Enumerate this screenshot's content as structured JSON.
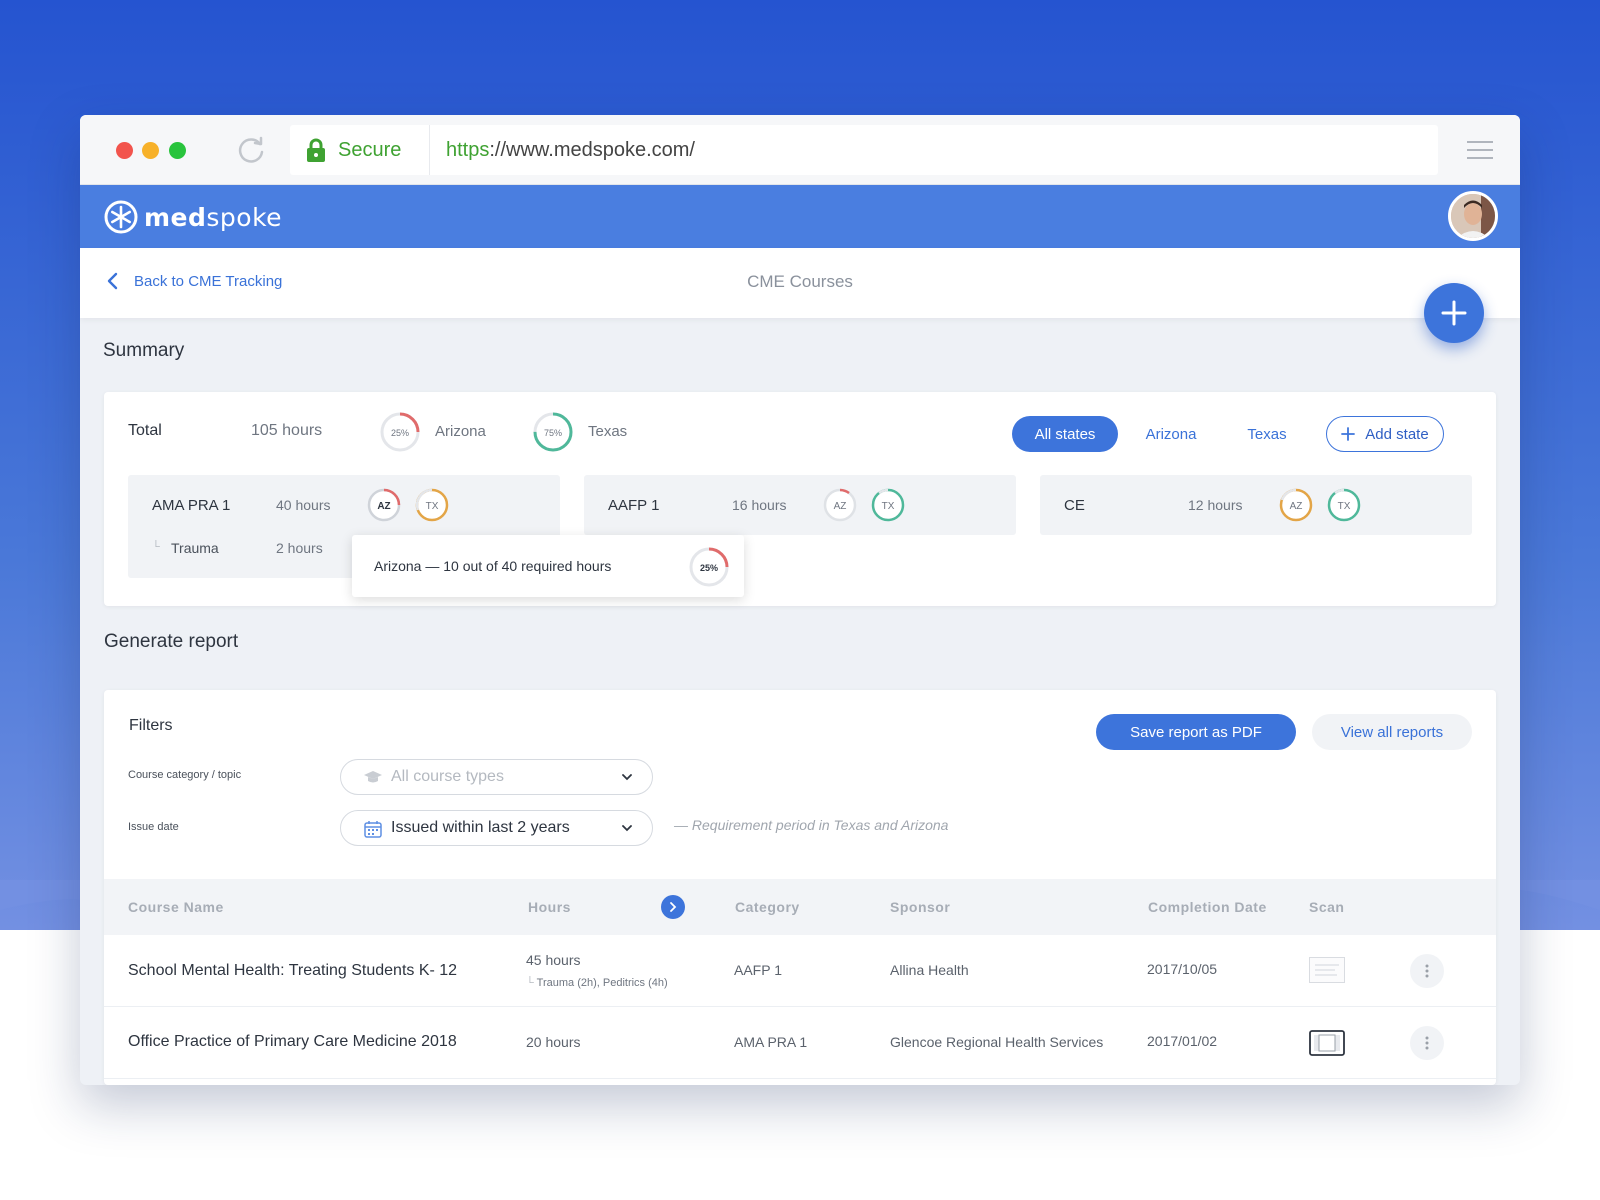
{
  "browser": {
    "secure_label": "Secure",
    "url_scheme": "https",
    "url_rest": "://www.medspoke.com/"
  },
  "app": {
    "logo_bold": "med",
    "logo_light": "spoke"
  },
  "nav": {
    "back_label": "Back to CME Tracking",
    "page_title": "CME Courses"
  },
  "summary": {
    "section_title": "Summary",
    "total_label": "Total",
    "total_value": "105 hours",
    "states": [
      {
        "name": "Arizona",
        "percent_label": "25%",
        "progress": 0.25,
        "color": "#e06b6b"
      },
      {
        "name": "Texas",
        "percent_label": "75%",
        "progress": 0.75,
        "color": "#4fb89a"
      }
    ],
    "filters": {
      "all_states": "All states",
      "arizona": "Arizona",
      "texas": "Texas",
      "add_state": "Add state"
    },
    "categories": [
      {
        "name": "AMA PRA 1",
        "hours": "40 hours",
        "badges": [
          "AZ",
          "TX"
        ],
        "sub": {
          "name": "Trauma",
          "hours": "2 hours"
        }
      },
      {
        "name": "AAFP 1",
        "hours": "16 hours",
        "badges": [
          "AZ",
          "TX"
        ]
      },
      {
        "name": "CE",
        "hours": "12 hours",
        "badges": [
          "AZ",
          "TX"
        ]
      }
    ],
    "tooltip": {
      "text": "Arizona — 10 out of 40 required hours",
      "percent_label": "25%",
      "progress": 0.25
    }
  },
  "report": {
    "section_title": "Generate report",
    "filters_title": "Filters",
    "save_pdf": "Save report as PDF",
    "view_all": "View all reports",
    "category_label": "Course category / topic",
    "category_placeholder": "All course types",
    "issue_label": "Issue date",
    "issue_value": "Issued within last 2 years",
    "issue_note": "Requirement period in Texas and Arizona",
    "columns": [
      "Course Name",
      "Hours",
      "Category",
      "Sponsor",
      "Completion Date",
      "Scan"
    ],
    "rows": [
      {
        "name": "School Mental Health: Treating Students K- 12",
        "hours": "45 hours",
        "hours_detail": "Trauma (2h),  Peditrics (4h)",
        "category": "AAFP 1",
        "sponsor": "Allina Health",
        "date": "2017/10/05"
      },
      {
        "name": "Office Practice of Primary Care Medicine 2018",
        "hours": "20 hours",
        "hours_detail": "",
        "category": "AMA PRA 1",
        "sponsor": "Glencoe Regional Health Services",
        "date": "2017/01/02"
      }
    ]
  },
  "colors": {
    "accent": "#3d74db",
    "header": "#4a7ee0",
    "secure_green": "#3fa232",
    "ring_red": "#e06b6b",
    "ring_green": "#4fb89a",
    "ring_orange": "#e3a547"
  }
}
